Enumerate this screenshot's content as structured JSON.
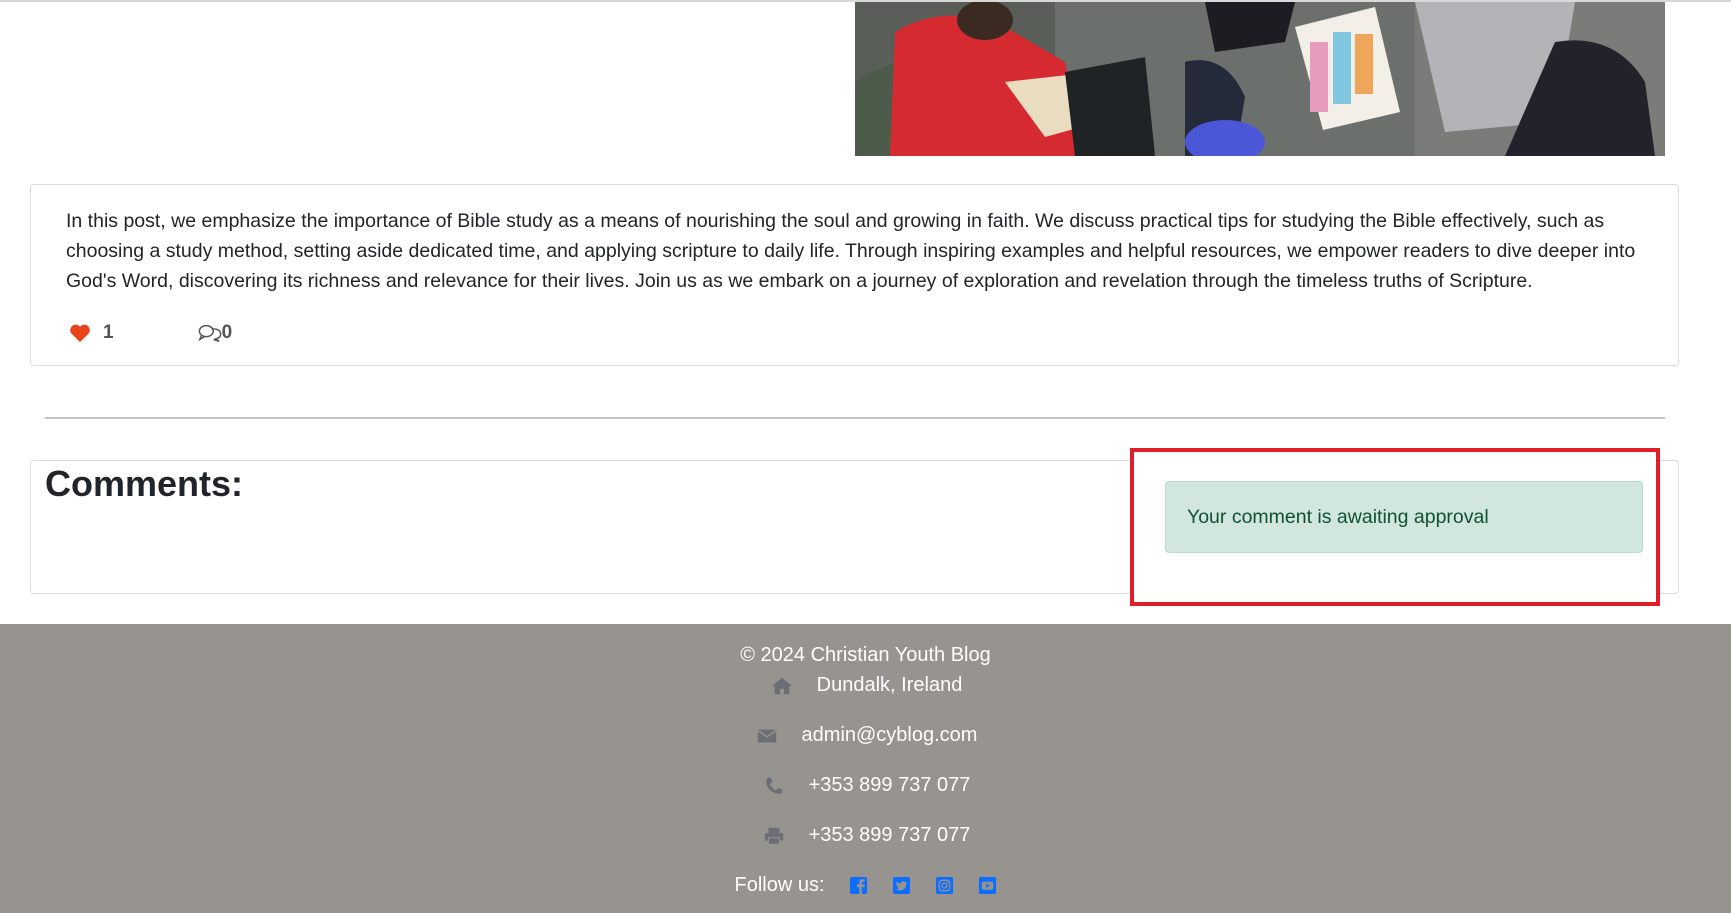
{
  "post": {
    "body": "In this post, we emphasize the importance of Bible study as a means of nourishing the soul and growing in faith. We discuss practical tips for studying the Bible effectively, such as choosing a study method, setting aside dedicated time, and applying scripture to daily life. Through inspiring examples and helpful resources, we empower readers to dive deeper into God's Word, discovering its richness and relevance for their lives. Join us as we embark on a journey of exploration and revelation through the timeless truths of Scripture.",
    "likes": "1",
    "comments_count": "0",
    "like_icon": "heart-icon",
    "comment_icon": "comment-icon"
  },
  "comments": {
    "title": "Comments:",
    "alert": "Your comment is awaiting approval"
  },
  "footer": {
    "copyright": "© 2024 Christian Youth Blog",
    "address": "Dundalk, Ireland",
    "email": "admin@cyblog.com",
    "phone": "+353 899 737 077",
    "fax": "+353 899 737 077",
    "follow_label": "Follow us:",
    "socials": [
      "facebook-icon",
      "twitter-icon",
      "instagram-icon",
      "youtube-icon"
    ]
  },
  "colors": {
    "heart": "#e8451e",
    "alert_bg": "#d1e7dd",
    "alert_text": "#0f5132",
    "highlight_border": "#e11d2a",
    "footer_bg": "#97938e",
    "social_blue": "#0d6efd"
  }
}
